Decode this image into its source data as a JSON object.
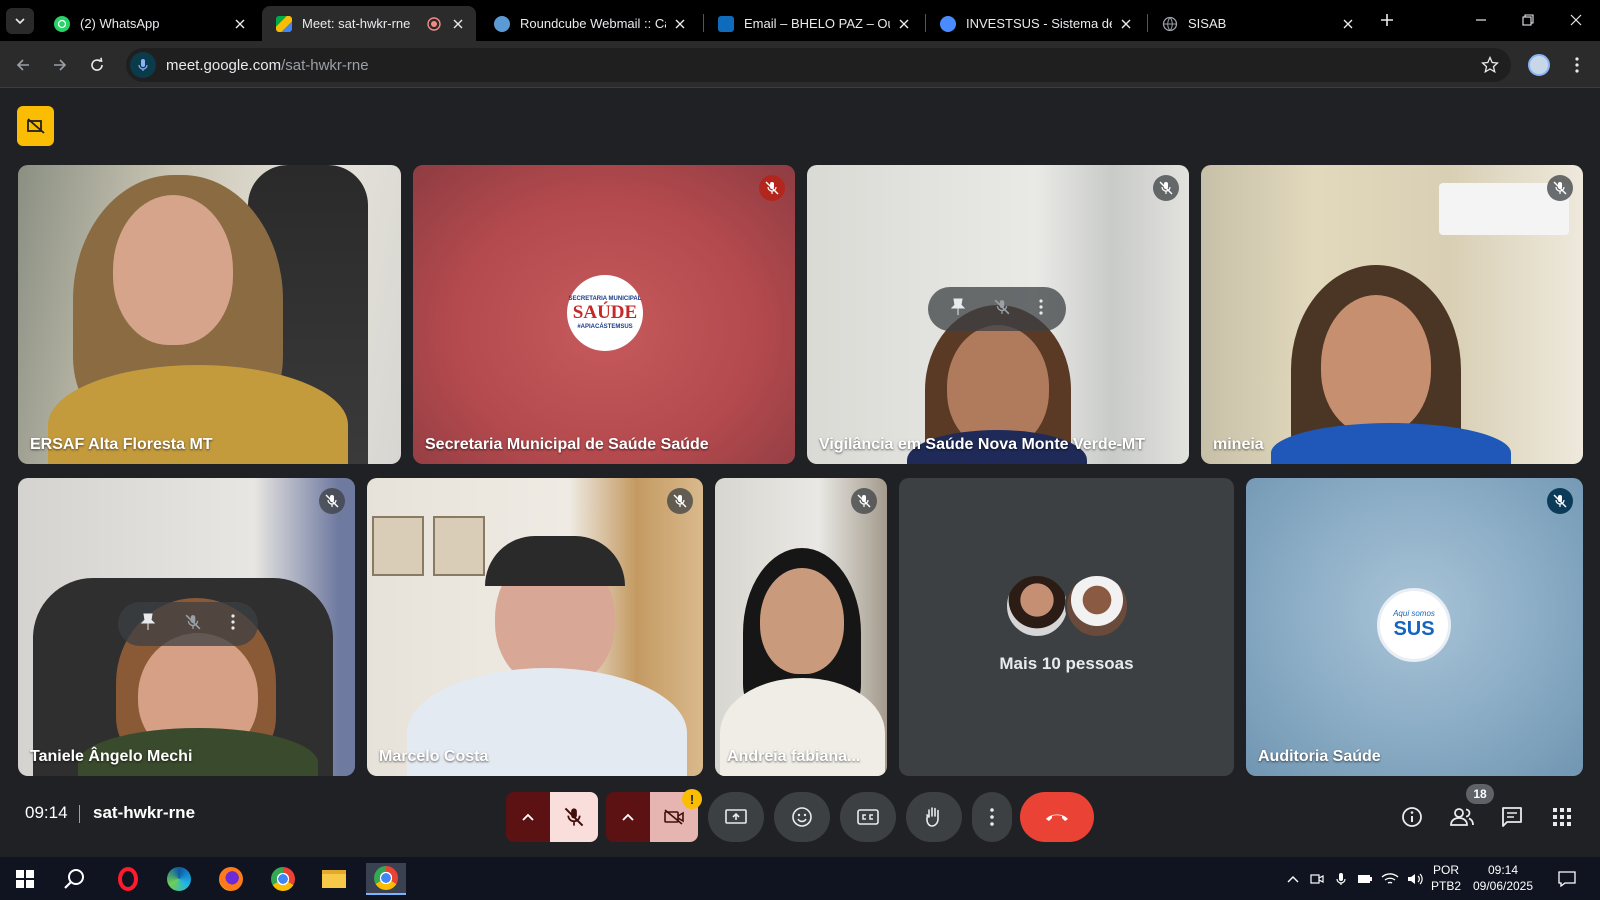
{
  "browser": {
    "tabs": [
      {
        "title": "(2) WhatsApp",
        "favicon": "whatsapp-icon",
        "color": "#25d366",
        "active": false
      },
      {
        "title": "Meet: sat-hwkr-rne",
        "favicon": "google-meet-icon",
        "color": "#00897b",
        "active": true
      },
      {
        "title": "Roundcube Webmail :: Cai",
        "favicon": "roundcube-icon",
        "color": "#5c9ad6",
        "active": false
      },
      {
        "title": "Email – BHELO PAZ – Outlo",
        "favicon": "outlook-icon",
        "color": "#0f6cbd",
        "active": false
      },
      {
        "title": "INVESTSUS - Sistema de In",
        "favicon": "investsus-icon",
        "color": "#4a8cff",
        "active": false
      },
      {
        "title": "SISAB",
        "favicon": "globe-icon",
        "color": "#9aa0a6",
        "active": false
      }
    ],
    "url_host": "meet.google.com",
    "url_path": "/sat-hwkr-rne"
  },
  "meet": {
    "participants": [
      {
        "name": "ERSAF Alta Floresta MT",
        "muted": false
      },
      {
        "name": "Secretaria Municipal de Saúde Saúde",
        "muted": true,
        "logo_text": "SAÚDE",
        "logo_small_top": "SECRETARIA MUNICIPAL",
        "logo_small_bottom": "#APIACÁSTEMSUS"
      },
      {
        "name": "Vigilância em Saúde Nova Monte Verde-MT",
        "muted": true
      },
      {
        "name": "mineia",
        "muted": true
      },
      {
        "name": "Taniele Ângelo Mechi",
        "muted": true
      },
      {
        "name": "Marcelo Costa",
        "muted": true
      },
      {
        "name": "Andreia fabiana...",
        "muted": true
      },
      {
        "name": "Auditoria Saúde",
        "muted": true,
        "logo_text": "SUS",
        "logo_small_top": "Aqui somos"
      }
    ],
    "others_label": "Mais 10 pessoas",
    "time": "09:14",
    "meeting_code": "sat-hwkr-rne",
    "people_count": "18",
    "camera_warning": "!"
  },
  "taskbar": {
    "lang_top": "POR",
    "lang_bottom": "PTB2",
    "clock_time": "09:14",
    "clock_date": "09/06/2025"
  }
}
